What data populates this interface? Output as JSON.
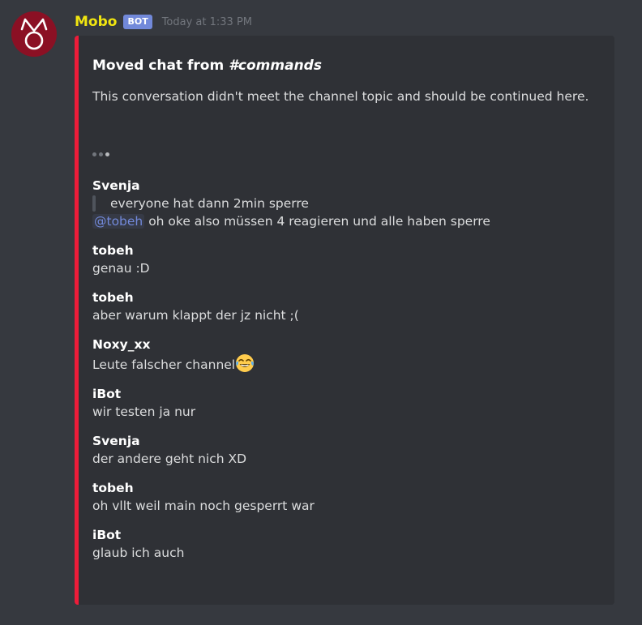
{
  "message": {
    "author": "Mobo",
    "badge": "BOT",
    "timestamp": "Today at 1:33 PM",
    "avatar_color": "#8b1024"
  },
  "embed": {
    "border_color": "#ed1c39",
    "title_prefix": "Moved chat from ",
    "title_channel": "#commands",
    "description": "This conversation didn't meet the channel topic and should be continued here.",
    "entries": [
      {
        "author": "Svenja",
        "quote": "everyone hat dann 2min sperre",
        "mention": "@tobeh",
        "text": " oh oke also müssen 4 reagieren und alle haben sperre"
      },
      {
        "author": "tobeh",
        "text": "genau :D"
      },
      {
        "author": "tobeh",
        "text": "aber warum klappt der jz nicht ;("
      },
      {
        "author": "Noxy_xx",
        "text": "Leute falscher channel",
        "emoji": "joy-emoji"
      },
      {
        "author": "iBot",
        "text": "wir testen ja nur"
      },
      {
        "author": "Svenja",
        "text": "der andere geht nich XD"
      },
      {
        "author": "tobeh",
        "text": "oh vllt weil main noch gesperrt war"
      },
      {
        "author": "iBot",
        "text": "glaub ich auch"
      }
    ]
  }
}
